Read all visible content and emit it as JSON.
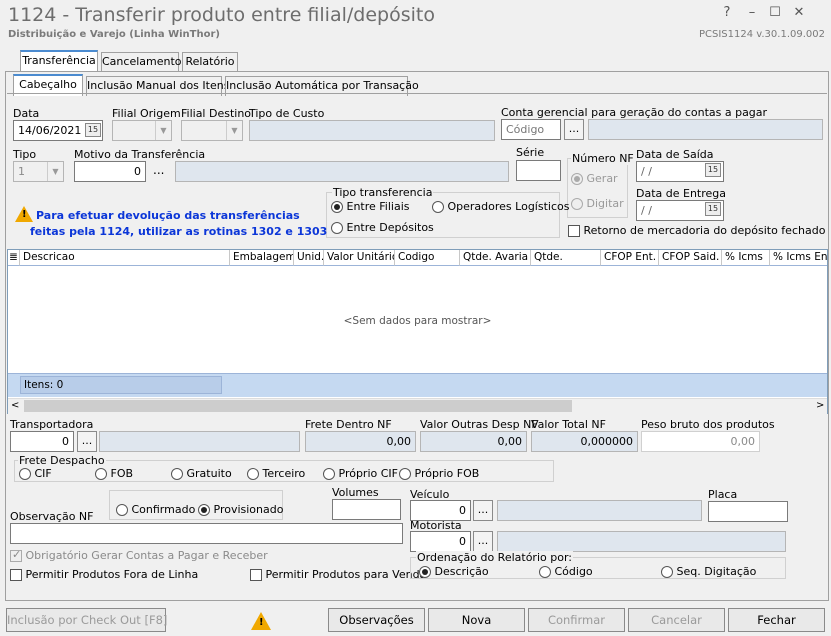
{
  "window": {
    "title": "1124 - Transferir produto entre filial/depósito",
    "subtitle": "Distribuição e Varejo (Linha WinThor)",
    "version": "PCSIS1124  v.30.1.09.002",
    "btn_help": "?",
    "btn_min": "–",
    "btn_max": "☐",
    "btn_close": "✕"
  },
  "tabs_top": [
    "Transferência",
    "Cancelamento",
    "Relatório"
  ],
  "tabs_sub": [
    "Cabeçalho",
    "Inclusão Manual dos Itens",
    "Inclusão Automática por Transação"
  ],
  "form": {
    "data_label": "Data",
    "data_value": "14/06/2021",
    "filial_origem_label": "Filial Origem",
    "filial_destino_label": "Filial Destino",
    "tipo_custo_label": "Tipo de Custo",
    "conta_label": "Conta gerencial para geração do contas a pagar",
    "conta_placeholder": "Código",
    "ellipsis": "...",
    "tipo_label": "Tipo",
    "tipo_value": "1",
    "motivo_label": "Motivo da Transferência",
    "motivo_value": "0",
    "serie_label": "Série",
    "numero_nf_label": "Número NF",
    "gerar_label": "Gerar",
    "digitar_label": "Digitar",
    "data_saida_label": "Data de Saída",
    "data_saida_value": "/ /",
    "data_entrega_label": "Data de Entrega",
    "data_entrega_value": "/ /",
    "tipo_transf_label": "Tipo transferencia",
    "entre_filiais": "Entre Filiais",
    "operadores": "Operadores Logísticos",
    "entre_depositos": "Entre Depósitos",
    "retorno_label": "Retorno de mercadoria do depósito fechado",
    "warning_line1": "Para efetuar devolução das transferências",
    "warning_line2": "feitas pela 1124, utilizar as rotinas 1302 e 1303"
  },
  "grid": {
    "columns": [
      "Descricao",
      "Embalagem",
      "Unid.",
      "Valor Unitário",
      "Codigo",
      "Qtde. Avaria",
      "Qtde.",
      "CFOP Ent.",
      "CFOP Said.",
      "% Icms",
      "% Icms Ent"
    ],
    "empty_text": "<Sem dados para mostrar>",
    "footer": "Itens: 0"
  },
  "bottom": {
    "transportadora_label": "Transportadora",
    "transportadora_value": "0",
    "frete_dentro_label": "Frete Dentro NF",
    "frete_dentro_value": "0,00",
    "valor_outras_label": "Valor Outras Desp NF",
    "valor_outras_value": "0,00",
    "valor_total_label": "Valor Total NF",
    "valor_total_value": "0,000000",
    "peso_label": "Peso bruto dos produtos",
    "peso_value": "0,00",
    "frete_despacho_label": "Frete Despacho",
    "frete_opts": [
      "CIF",
      "FOB",
      "Gratuito",
      "Terceiro",
      "Próprio CIF",
      "Próprio FOB"
    ],
    "confirmado": "Confirmado",
    "provisionado": "Provisionado",
    "volumes_label": "Volumes",
    "veiculo_label": "Veículo",
    "veiculo_value": "0",
    "placa_label": "Placa",
    "motorista_label": "Motorista",
    "motorista_value": "0",
    "obs_label": "Observação NF",
    "obrigatorio_label": "Obrigatório Gerar Contas a Pagar e Receber",
    "permitir_fora_label": "Permitir Produtos Fora de Linha",
    "permitir_venda_label": "Permitir Produtos para Venda",
    "ordenacao_label": "Ordenação do Relatório por:",
    "ord_opts": [
      "Descrição",
      "Código",
      "Seq. Digitação"
    ]
  },
  "footer": {
    "checkout": "Inclusão por Check Out  [F8]",
    "observacoes": "Observações",
    "nova": "Nova",
    "confirmar": "Confirmar",
    "cancelar": "Cancelar",
    "fechar": "Fechar"
  }
}
